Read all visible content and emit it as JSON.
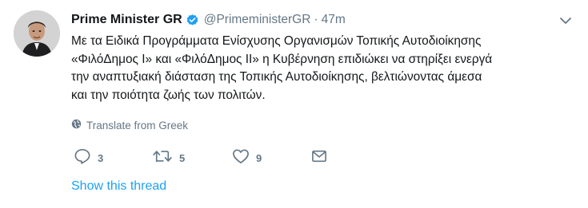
{
  "tweet": {
    "display_name": "Prime Minister GR",
    "handle": "@PrimeministerGR",
    "separator": "·",
    "time": "47m",
    "text_lines": [
      "Με τα Ειδικά Προγράμματα Ενίσχυσης Οργανισμών Τοπικής Αυτοδιοίκησης",
      "«ΦιλόΔημος Ι» και «ΦιλόΔημος ΙΙ» η Κυβέρνηση επιδιώκει να στηρίξει ενεργά",
      "την αναπτυξιακή διάσταση της Τοπικής Αυτοδιοίκησης, βελτιώνοντας άμεσα",
      "και την ποιότητα ζωής των πολιτών."
    ],
    "translate_label": "Translate from Greek",
    "actions": {
      "reply_count": "3",
      "retweet_count": "5",
      "like_count": "9"
    },
    "show_thread_label": "Show this thread"
  },
  "icons": {
    "verified": "verified-badge-icon",
    "caret": "chevron-down-icon",
    "globe": "globe-icon",
    "reply": "reply-icon",
    "retweet": "retweet-icon",
    "like": "heart-icon",
    "dm": "envelope-icon"
  },
  "colors": {
    "accent": "#1da1f2",
    "secondary_text": "#657786",
    "icon_gray": "#657786",
    "text": "#14171a"
  }
}
